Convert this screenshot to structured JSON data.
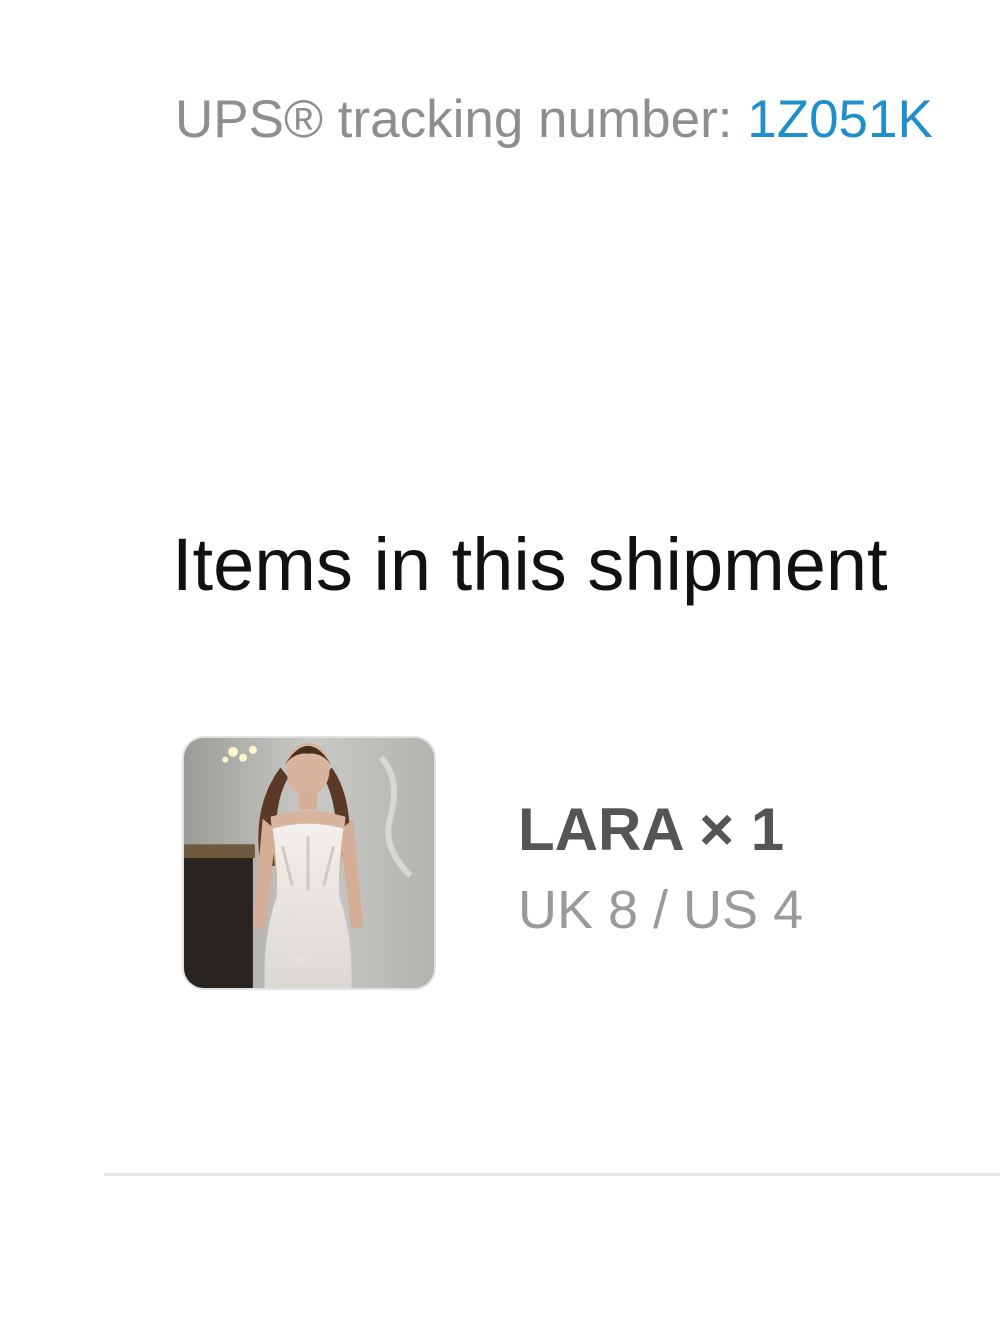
{
  "tracking": {
    "label": "UPS® tracking number: ",
    "number": "1Z051K",
    "link_color": "#1f8fc9"
  },
  "shipment": {
    "heading": "Items in this shipment",
    "items": [
      {
        "name_line": "LARA × 1",
        "variant": "UK 8 / US 4",
        "image": "product-photo-white-lace-dress"
      }
    ]
  }
}
